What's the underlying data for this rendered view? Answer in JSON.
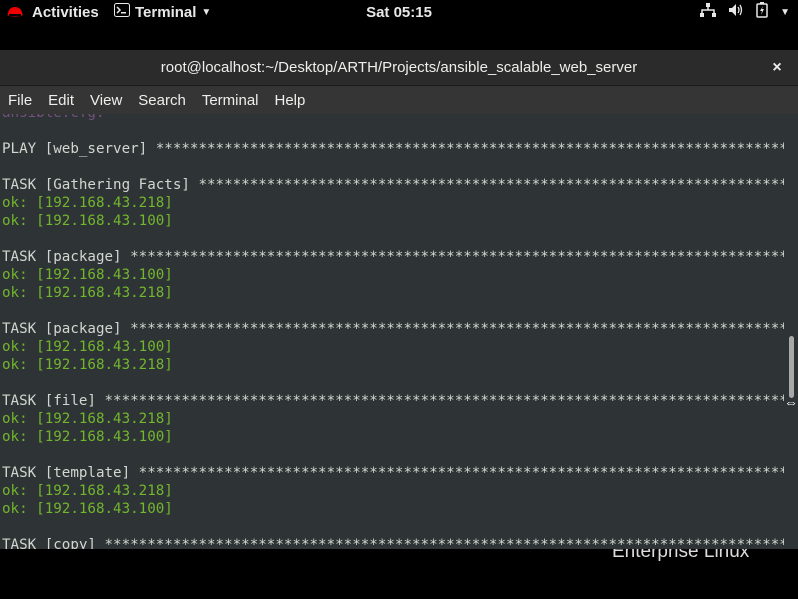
{
  "topbar": {
    "activities": "Activities",
    "app_name": "Terminal",
    "clock": "Sat 05:15",
    "icons": [
      "redhat-icon",
      "terminal-icon",
      "network-icon",
      "volume-icon",
      "battery-icon",
      "chevron-down-icon"
    ]
  },
  "window": {
    "title": "root@localhost:~/Desktop/ARTH/Projects/ansible_scalable_web_server",
    "close": "×"
  },
  "menubar": [
    "File",
    "Edit",
    "View",
    "Search",
    "Terminal",
    "Help"
  ],
  "terminal": {
    "lines": [
      {
        "text": "ansible.cfg.",
        "style": "purple"
      },
      {
        "text": "",
        "style": ""
      },
      {
        "text": "PLAY [web_server] ************************************************************************************",
        "style": ""
      },
      {
        "text": "",
        "style": ""
      },
      {
        "text": "TASK [Gathering Facts] *******************************************************************************",
        "style": ""
      },
      {
        "text": "ok: [192.168.43.218]",
        "style": "ok"
      },
      {
        "text": "ok: [192.168.43.100]",
        "style": "ok"
      },
      {
        "text": "",
        "style": ""
      },
      {
        "text": "TASK [package] ***************************************************************************************",
        "style": ""
      },
      {
        "text": "ok: [192.168.43.100]",
        "style": "ok"
      },
      {
        "text": "ok: [192.168.43.218]",
        "style": "ok"
      },
      {
        "text": "",
        "style": ""
      },
      {
        "text": "TASK [package] ***************************************************************************************",
        "style": ""
      },
      {
        "text": "ok: [192.168.43.100]",
        "style": "ok"
      },
      {
        "text": "ok: [192.168.43.218]",
        "style": "ok"
      },
      {
        "text": "",
        "style": ""
      },
      {
        "text": "TASK [file] ******************************************************************************************",
        "style": ""
      },
      {
        "text": "ok: [192.168.43.218]",
        "style": "ok"
      },
      {
        "text": "ok: [192.168.43.100]",
        "style": "ok"
      },
      {
        "text": "",
        "style": ""
      },
      {
        "text": "TASK [template] **************************************************************************************",
        "style": ""
      },
      {
        "text": "ok: [192.168.43.218]",
        "style": "ok"
      },
      {
        "text": "ok: [192.168.43.100]",
        "style": "ok"
      },
      {
        "text": "",
        "style": ""
      },
      {
        "text": "TASK [copy] ******************************************************************************************",
        "style": ""
      }
    ]
  },
  "desktop": {
    "watermark": "Enterprise Linux"
  }
}
